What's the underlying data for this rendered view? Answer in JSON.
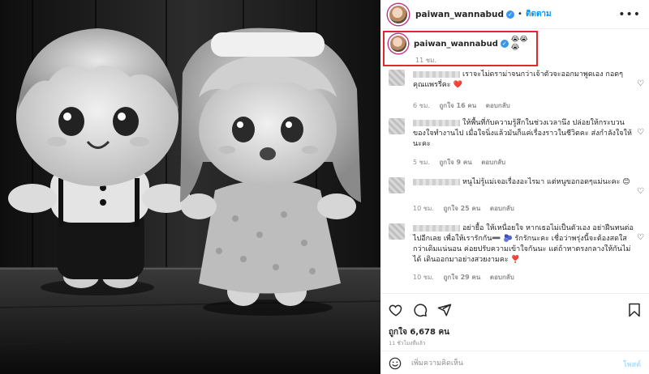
{
  "header": {
    "username": "paiwan_wannabud",
    "verified_glyph": "✓",
    "separator": "•",
    "follow_label": "ติดตาม",
    "more_glyph": "•••"
  },
  "caption": {
    "username": "paiwan_wannabud",
    "verified_glyph": "✓",
    "emojis": "😭😭😭",
    "time": "11 ชม."
  },
  "comments": [
    {
      "text": "เราจะไม่ดราม่าจนกว่าเจ้าตัวจะออกมาพูดเอง กอดๆ คุณแพรรี่คะ ❤️",
      "time": "6 ชม.",
      "likes": "ถูกใจ 16 คน",
      "reply": "ตอบกลับ"
    },
    {
      "text": "ให้พื้นที่กับความรู้สึกในช่วงเวลานึง ปล่อยให้กระบวนของใจทำงานไป เมื่อใจนิ่งแล้วมันก็แค่เรื่องราวในชีวิตคะ ส่งกำลังใจให้นะคะ",
      "time": "5 ชม.",
      "likes": "ถูกใจ 9 คน",
      "reply": "ตอบกลับ"
    },
    {
      "text": "หนูไม่รู้แม่เจอเรื่องอะไรมา แต่หนูขอกอดๆแม่นะคะ 😊",
      "time": "10 ชม.",
      "likes": "ถูกใจ 25 คน",
      "reply": "ตอบกลับ"
    },
    {
      "text": "อย่ายื้อ ให้เหนื่อยใจ หากเธอไม่เป็นตัวเอง อย่าฝืนทนต่อไปอีกเลย เพื่อให้เรารักกัน➖ 🫐 รักรักนะคะ เชื่อว่าพรุ่งนี้จะต้องสดใสกว่าเดิมแน่นอน ค่อยปรับความเข้าใจกันนะ แต่ถ้าหาตรงกลางให้กันไม่ได้ เดินออกมาอย่างสวยงามคะ ❣️",
      "time": "10 ชม.",
      "likes": "ถูกใจ 29 คน",
      "reply": "ตอบกลับ"
    }
  ],
  "actions": {
    "likes_text": "ถูกใจ 6,678 คน",
    "ago_text": "11 ชั่วโมงที่แล้ว"
  },
  "add_comment": {
    "placeholder": "เพิ่มความคิดเห็น",
    "post_label": "โพสต์"
  },
  "icons": {
    "like": "heart-icon",
    "comment": "comment-icon",
    "share": "share-icon",
    "save": "bookmark-icon",
    "emoji": "smile-icon"
  },
  "colors": {
    "follow": "#0095f6",
    "highlight_box": "#e0282f",
    "verified": "#3897f0",
    "post_disabled": "#b2dffc"
  }
}
